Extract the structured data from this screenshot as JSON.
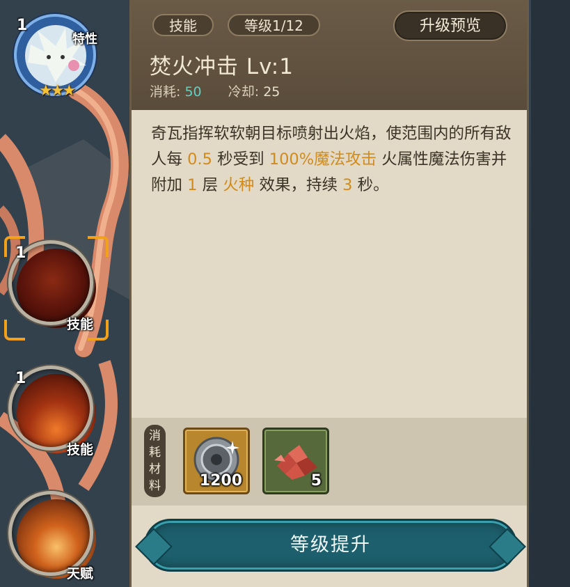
{
  "left_nodes": {
    "trait": {
      "level": "1",
      "tag": "特性",
      "stars": "★★★"
    },
    "skill_1": {
      "level": "1",
      "tag": "技能"
    },
    "skill_2": {
      "level": "1",
      "tag": "技能"
    },
    "talent": {
      "tag": "天赋"
    }
  },
  "panel": {
    "tab_skill": "技能",
    "tab_level": "等级1/12",
    "preview_button": "升级预览",
    "skill_name": "焚火冲击 Lv:1",
    "cost_label": "消耗:",
    "cost_value": "50",
    "cooldown_label": "冷却:",
    "cooldown_value": "25",
    "description": {
      "p1": "奇瓦指挥软软朝目标喷射出火焰，使范围内的所有敌人每",
      "interval": "0.5",
      "p2": "秒受到",
      "damage": "100%魔法攻击",
      "p3": "火属性魔法伤害并附加",
      "stacks": "1",
      "p4": "层",
      "effect": "火种",
      "p5": "效果，持续",
      "duration": "3",
      "p6": "秒。"
    },
    "materials_label": "消耗材料",
    "materials": [
      {
        "icon": "silver-coin-icon",
        "count": "1200"
      },
      {
        "icon": "red-crystal-shards-icon",
        "count": "5"
      }
    ],
    "upgrade_button": "等级提升"
  },
  "colors": {
    "highlight": "#d08b1c",
    "cost_value": "#5fd1c3",
    "selection": "#f2a11b",
    "button_teal": "#1d5f6c"
  }
}
